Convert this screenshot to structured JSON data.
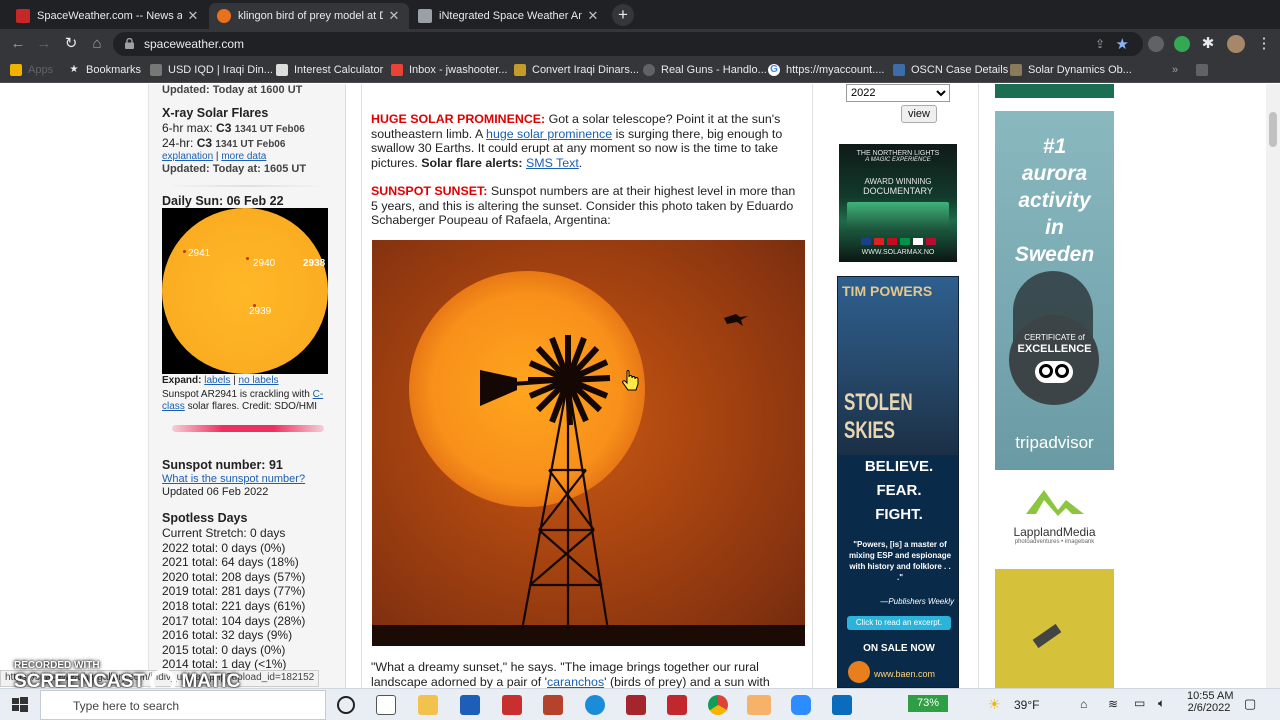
{
  "tabs": [
    {
      "title": "SpaceWeather.com -- News and",
      "fav_color": "#c62828",
      "active": false
    },
    {
      "title": "klingon bird of prey model at Du",
      "fav_color": "#e8711c",
      "active": true
    },
    {
      "title": "iNtegrated Space Weather Analy",
      "fav_color": "#9aa0a6",
      "active": false
    }
  ],
  "address": {
    "url": "spaceweather.com"
  },
  "bookmarks": [
    "Apps",
    "Bookmarks",
    "USD IQD | Iraqi Din...",
    "Interest Calculator",
    "Inbox - jwashooter...",
    "Convert Iraqi Dinars...",
    "Real Guns - Handlo...",
    "https://myaccount....",
    "OSCN Case Details",
    "Solar Dynamics Ob..."
  ],
  "left": {
    "updated1": "Updated: Today at 1600 UT",
    "xray_title": "X-ray Solar Flares",
    "xray_6hr_label": "6-hr max:",
    "xray_6hr_class": "C3",
    "xray_6hr_time": "1341 UT Feb06",
    "xray_24hr_label": "24-hr:",
    "xray_24hr_class": "C3",
    "xray_24hr_time": "1341 UT Feb06",
    "explanation": "explanation",
    "more_data": "more data",
    "updated2": "Updated: Today at: 1605 UT",
    "daily_sun": "Daily Sun: 06 Feb 22",
    "spots": [
      "2941",
      "2940",
      "2938",
      "2939"
    ],
    "expand": "Expand:",
    "labels": "labels",
    "no_labels": "no labels",
    "caption_a": "Sunspot AR2941 is crackling with",
    "caption_link": "C-class",
    "caption_b": "solar flares. Credit: SDO/HMI",
    "sunspot_number": "Sunspot number: 91",
    "what_is": "What is the sunspot number?",
    "updated3": "Updated 06 Feb 2022",
    "spotless_title": "Spotless Days",
    "spotless": [
      "Current Stretch: 0 days",
      "2022 total: 0 days (0%)",
      "2021 total: 64 days (18%)",
      "2020 total: 208 days (57%)",
      "2019 total: 281 days (77%)",
      "2018 total: 221 days (61%)",
      "2017 total: 104 days (28%)",
      "2016 total: 32 days (9%)",
      "2015 total: 0 days (0%)",
      "2014 total: 1 day (<1%)"
    ]
  },
  "main": {
    "p1_head": "HUGE SOLAR PROMINENCE:",
    "p1_a": "Got a solar telescope? Point it at the sun's southeastern limb. A",
    "p1_link": "huge solar prominence",
    "p1_b": "is surging there, big enough to swallow 30 Earths. It could erupt at any moment so now is the time to take pictures.",
    "p1_alert": "Solar flare alerts:",
    "p1_sms": "SMS Text",
    "p2_head": "SUNSPOT SUNSET:",
    "p2_body": "Sunspot numbers are at their highest level in more than 5 years, and this is altering the sunset. Consider this photo taken by Eduardo Schaberger Poupeau of Rafaela, Argentina:",
    "p3_a": "\"What a dreamy sunset,\" he says. \"The image brings together our rural landscape adorned by a pair of '",
    "p3_link": "caranchos",
    "p3_b": "' (birds of prey) and a sun with many"
  },
  "ads": {
    "year_select": "2022",
    "view_btn": "view",
    "nl_line1": "THE NORTHERN LIGHTS",
    "nl_line2": "A MAGIC EXPERIENCE",
    "nl_line3": "AWARD WINNING",
    "nl_line4": "DOCUMENTARY",
    "nl_url": "WWW.SOLARMAX.NO",
    "tp_author": "TIM POWERS",
    "tp_title": "STOLEN SKIES",
    "tp_slogan": [
      "BELIEVE.",
      "FEAR.",
      "FIGHT."
    ],
    "tp_quote": "\"Powers, [is] a master of mixing ESP and espionage with history and folklore . . .\"",
    "tp_source": "—Publishers Weekly",
    "tp_btn": "Click to read an excerpt.",
    "tp_sale": "ON SALE NOW",
    "tp_url": "www.baen.com",
    "se_1": "#1",
    "se_2": "aurora",
    "se_3": "activity",
    "se_4": "in",
    "se_5": "Sweden",
    "se_cert1": "CERTIFICATE of",
    "se_cert2": "EXCELLENCE",
    "se_trip": "tripadvisor",
    "lap_name": "LapplandMedia",
    "lap_sub": "photoadventures • imagebank"
  },
  "status_url": "https://spaceweathergallery.com/indiv_upload.php?upload_id=182152",
  "watermark_1": "RECORDED WITH",
  "watermark_2": "SCREENCAST",
  "watermark_3": "MATIC",
  "taskbar": {
    "search_placeholder": "Type here to search",
    "battery": "73%",
    "weather": "39°F",
    "time": "10:55 AM",
    "date": "2/6/2022"
  }
}
